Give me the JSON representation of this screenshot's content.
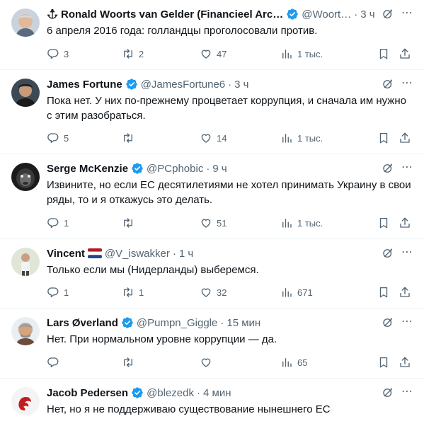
{
  "colors": {
    "verified": "#1d9bf0",
    "muted": "#536471",
    "text": "#0f1419",
    "divider": "#eff3f4"
  },
  "tweets": [
    {
      "name": "Ronald Woorts van Gelder (Financieel Arc…",
      "handle": "@Woort…",
      "time": "3 ч",
      "text": "6 апреля 2016 года: голландцы проголосовали против.",
      "replies": "3",
      "retweets": "2",
      "likes": "47",
      "views": "1 тыс.",
      "icons": [
        "anchor-icon",
        "verified-icon"
      ]
    },
    {
      "name": "James Fortune",
      "handle": "@JamesFortune6",
      "time": "3 ч",
      "text": "Пока нет. У них по-прежнему процветает коррупция, и сначала им нужно с этим разобраться.",
      "replies": "5",
      "retweets": "",
      "likes": "14",
      "views": "1 тыс."
    },
    {
      "name": "Serge McKenzie",
      "handle": "@PCphobic",
      "time": "9 ч",
      "text": "Извините, но если ЕС десятилетиями не хотел принимать Украину в свои ряды, то и я откажусь это делать.",
      "replies": "1",
      "retweets": "",
      "likes": "51",
      "views": "1 тыс."
    },
    {
      "name": "Vincent",
      "handle": "@V_iswakker",
      "time": "1 ч",
      "text": "Только если мы (Нидерланды) выберемся.",
      "replies": "1",
      "retweets": "1",
      "likes": "32",
      "views": "671",
      "icons": [
        "netherlands-flag-icon"
      ]
    },
    {
      "name": "Lars Øverland",
      "handle": "@Pumpn_Giggle",
      "time": "15 мин",
      "text": "Нет. При нормальном уровне коррупции — да.",
      "replies": "",
      "retweets": "",
      "likes": "",
      "views": "65"
    },
    {
      "name": "Jacob Pedersen",
      "handle": "@blezedk",
      "time": "4 мин",
      "text": "Нет, но я не поддерживаю существование нынешнего ЕС"
    }
  ]
}
